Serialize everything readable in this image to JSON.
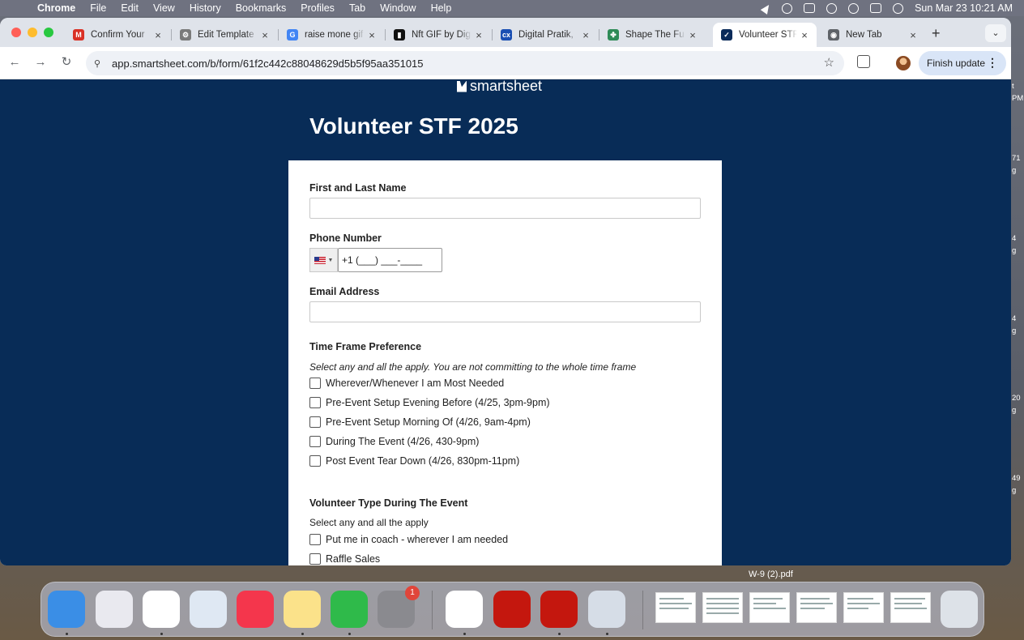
{
  "menubar": {
    "app_name": "Chrome",
    "items": [
      "File",
      "Edit",
      "View",
      "History",
      "Bookmarks",
      "Profiles",
      "Tab",
      "Window",
      "Help"
    ],
    "datetime": "Sun Mar 23  10:21 AM"
  },
  "tabs": [
    {
      "label": "Confirm Your",
      "favicon": "gmail-icon",
      "color": "#d93025",
      "glyph": "M",
      "active": false
    },
    {
      "label": "Edit Template",
      "favicon": "gear-icon",
      "color": "#7a7a7a",
      "glyph": "⚙",
      "active": false
    },
    {
      "label": "raise mone gif",
      "favicon": "google-icon",
      "color": "#4285f4",
      "glyph": "G",
      "active": false
    },
    {
      "label": "Nft GIF by Dig",
      "favicon": "giphy-icon",
      "color": "#111111",
      "glyph": "▮",
      "active": false
    },
    {
      "label": "Digital Pratik,",
      "favicon": "cxo-icon",
      "color": "#1a4fb3",
      "glyph": "cx",
      "active": false
    },
    {
      "label": "Shape The Fu",
      "favicon": "shape-icon",
      "color": "#2e8b57",
      "glyph": "✤",
      "active": false
    },
    {
      "label": "Volunteer STF",
      "favicon": "smartsheet-icon",
      "color": "#0b2b5a",
      "glyph": "✓",
      "active": true
    },
    {
      "label": "New Tab",
      "favicon": "chrome-icon",
      "color": "#5f6368",
      "glyph": "◉",
      "active": false
    }
  ],
  "tab_close_glyph": "×",
  "new_tab_glyph": "+",
  "tab_menu_glyph": "⌄",
  "toolbar": {
    "back_glyph": "←",
    "forward_glyph": "→",
    "reload_glyph": "↻",
    "url": "app.smartsheet.com/b/form/61f2c442c88048629d5b5f95aa351015",
    "bookmark_glyph": "☆",
    "finish_update_label": "Finish update",
    "menu_glyph": "⋮"
  },
  "form": {
    "brand": "smartsheet",
    "title": "Volunteer STF 2025",
    "questions": {
      "name_label": "First and Last Name",
      "phone_label": "Phone Number",
      "phone_value": "+1 (___) ___-____",
      "email_label": "Email Address",
      "timeframe_label": "Time Frame Preference",
      "timeframe_hint": "Select any and all the apply. You are not committing to the whole time frame",
      "timeframe_options": [
        "Wherever/Whenever I am Most Needed",
        "Pre-Event Setup Evening Before (4/25, 3pm-9pm)",
        "Pre-Event Setup Morning Of (4/26, 9am-4pm)",
        "During The Event (4/26, 430-9pm)",
        "Post Event Tear Down (4/26, 830pm-11pm)"
      ],
      "voltype_label": "Volunteer Type During The Event",
      "voltype_hint": "Select any and all the apply",
      "voltype_options": [
        "Put me in coach - wherever I am needed",
        "Raffle Sales"
      ]
    }
  },
  "peek_text": [
    "t",
    "PM",
    "71",
    "g",
    "4",
    "g",
    "4",
    "g",
    "20",
    "g",
    "49",
    "g"
  ],
  "dock": {
    "badge_count": "1",
    "hover_label": "W-9 (2).pdf",
    "apps": [
      {
        "name": "finder-icon",
        "color": "#3a8ee6"
      },
      {
        "name": "launchpad-icon",
        "color": "#e9e9ef"
      },
      {
        "name": "chrome-icon",
        "color": "#ffffff"
      },
      {
        "name": "app-store-icon",
        "color": "#dfe8f3"
      },
      {
        "name": "music-icon",
        "color": "#f4364c"
      },
      {
        "name": "notes-icon",
        "color": "#fbe28a"
      },
      {
        "name": "numbers-icon",
        "color": "#2fba4a"
      },
      {
        "name": "system-settings-icon",
        "color": "#8a8a8f"
      },
      {
        "name": "word-icon",
        "color": "#ffffff"
      },
      {
        "name": "acrobat-icon",
        "color": "#c4170e"
      },
      {
        "name": "acrobat-icon-2",
        "color": "#c4170e"
      },
      {
        "name": "preview-icon",
        "color": "#d6dde7"
      },
      {
        "name": "trash-icon",
        "color": "#dde2e8"
      }
    ]
  }
}
